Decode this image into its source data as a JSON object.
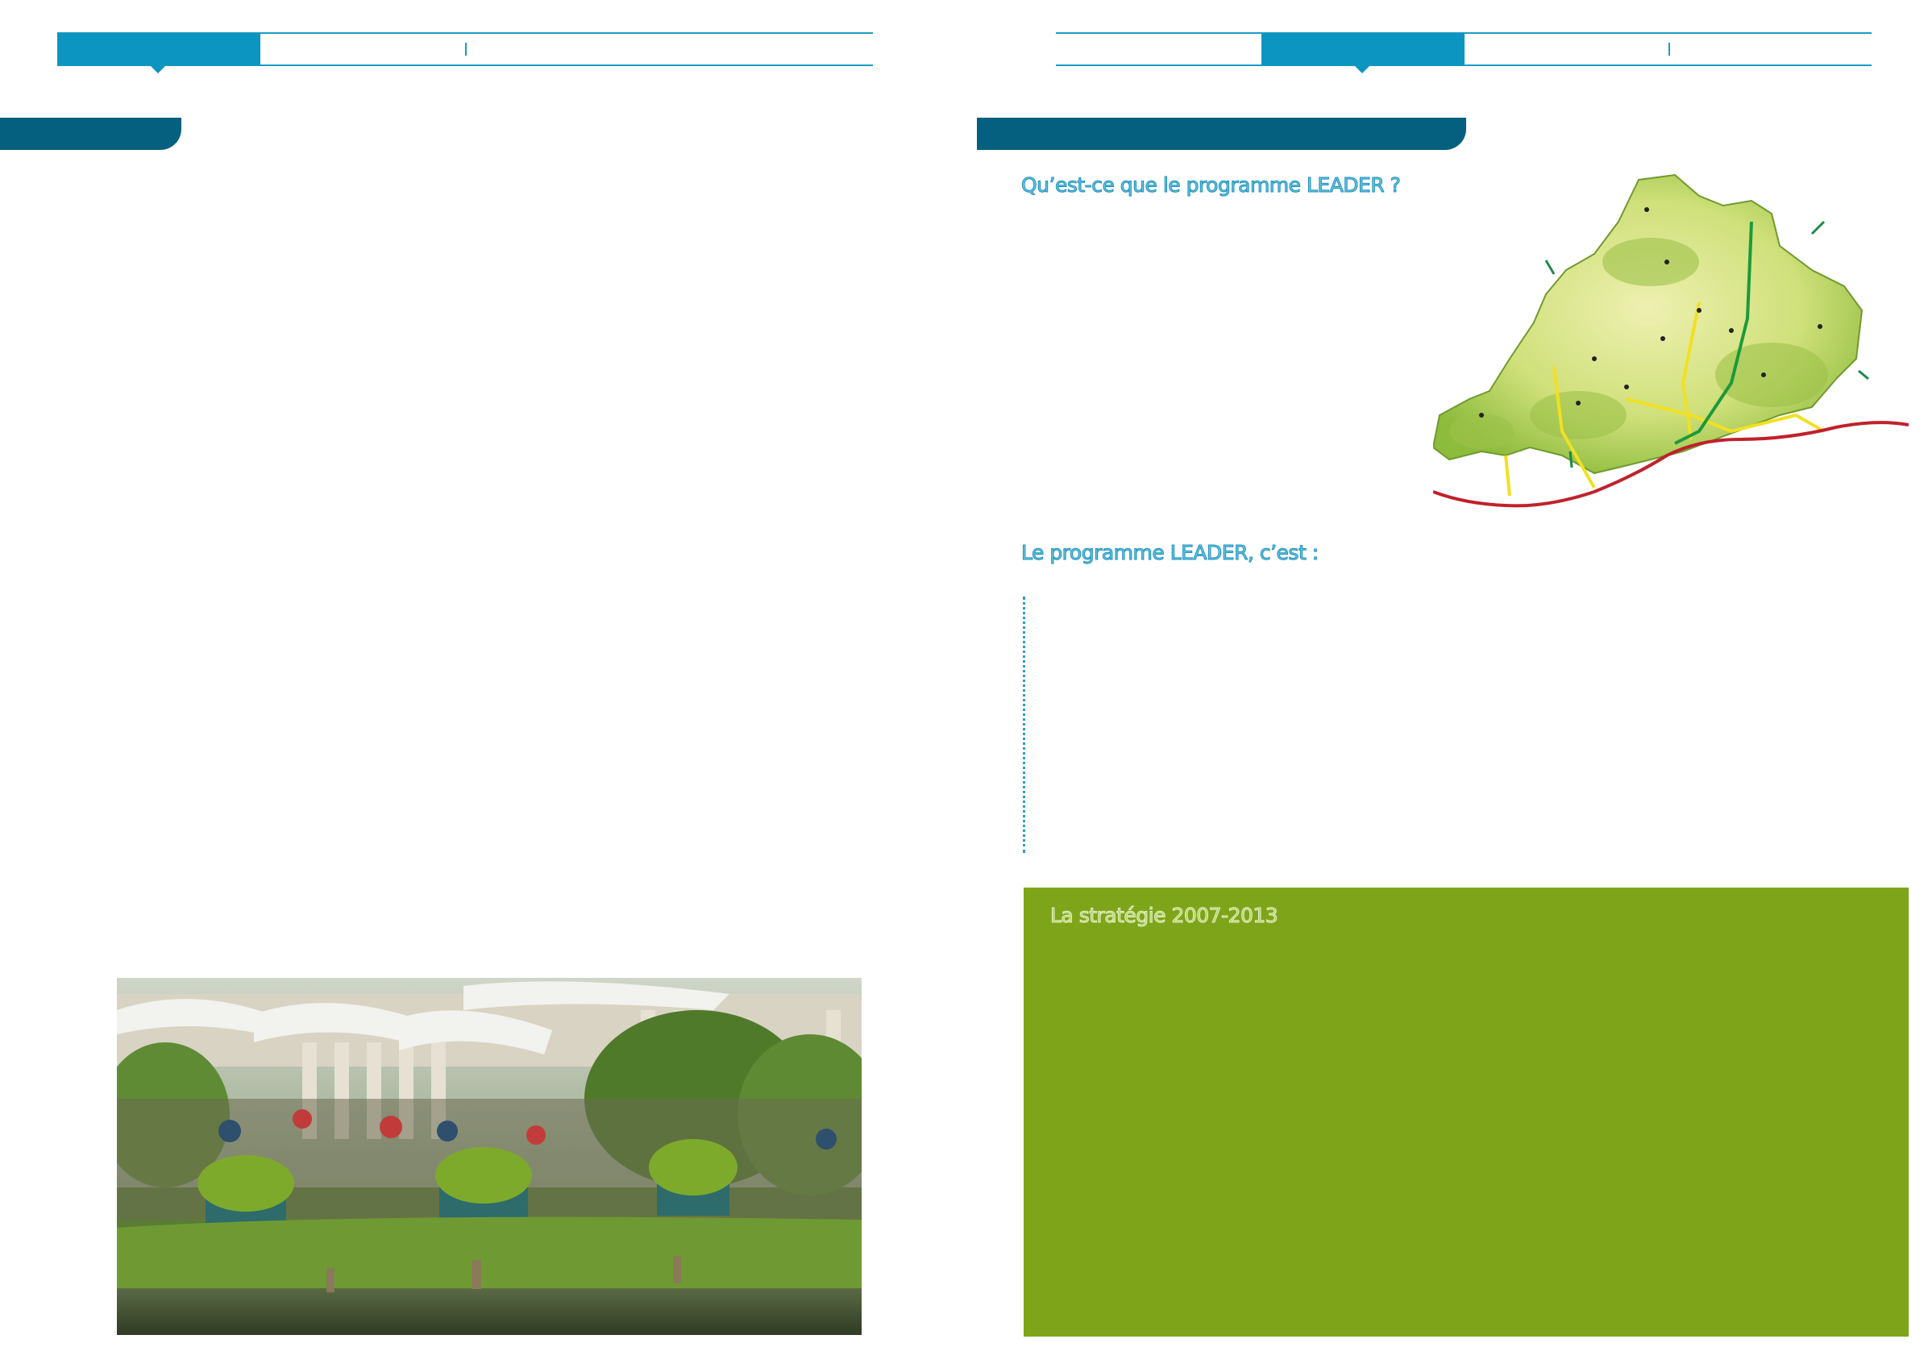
{
  "right_page": {
    "section1_heading": "Qu’est-ce que le programme LEADER ?",
    "section2_heading": "Le programme LEADER, c’est :",
    "green_box_heading": "La stratégie 2007-2013"
  },
  "colors": {
    "primary_blue": "#0d95c1",
    "dark_teal": "#04607e",
    "rule_blue": "#1a9bc4",
    "green_box": "#7ea51a"
  },
  "images": {
    "left_photo": "photo-icon",
    "territory_map": "map-icon"
  }
}
